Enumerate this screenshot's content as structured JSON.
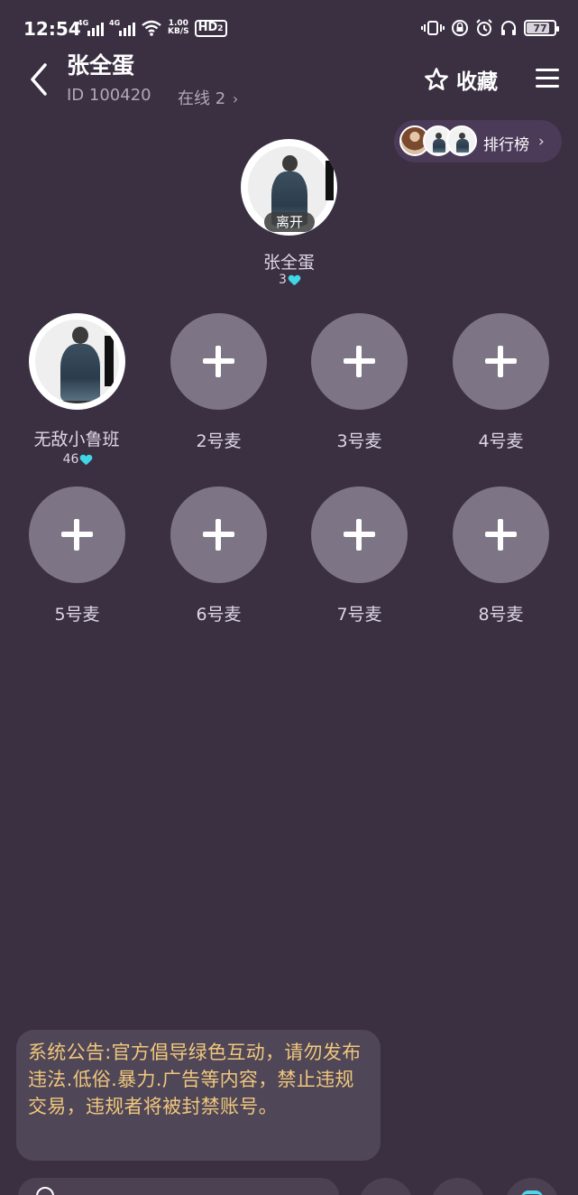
{
  "status_bar": {
    "time": "12:54",
    "net_1": "4G",
    "net_2": "4G",
    "speed_value": "1.00",
    "speed_unit": "KB/S",
    "hd": "HD",
    "hd_sub": "2",
    "battery": "77"
  },
  "header": {
    "title": "张全蛋",
    "room_id": "ID 100420",
    "online": "在线 2",
    "favorite_label": "收藏"
  },
  "ranking": {
    "label": "排行榜"
  },
  "host": {
    "name": "张全蛋",
    "count": "3",
    "status_badge": "离开"
  },
  "seats": [
    {
      "label": "无敌小鲁班",
      "count": "46",
      "occupied": true
    },
    {
      "label": "2号麦"
    },
    {
      "label": "3号麦"
    },
    {
      "label": "4号麦"
    },
    {
      "label": "5号麦"
    },
    {
      "label": "6号麦"
    },
    {
      "label": "7号麦"
    },
    {
      "label": "8号麦"
    }
  ],
  "notice": {
    "text": "系统公告:官方倡导绿色互动，请勿发布违法.低俗.暴力.广告等内容，禁止违规交易，违规者将被封禁账号。"
  },
  "colors": {
    "background": "#3a3042",
    "seat_empty": "#7d7585",
    "notice_text": "#f0c77b",
    "heart": "#3fd6e6"
  }
}
